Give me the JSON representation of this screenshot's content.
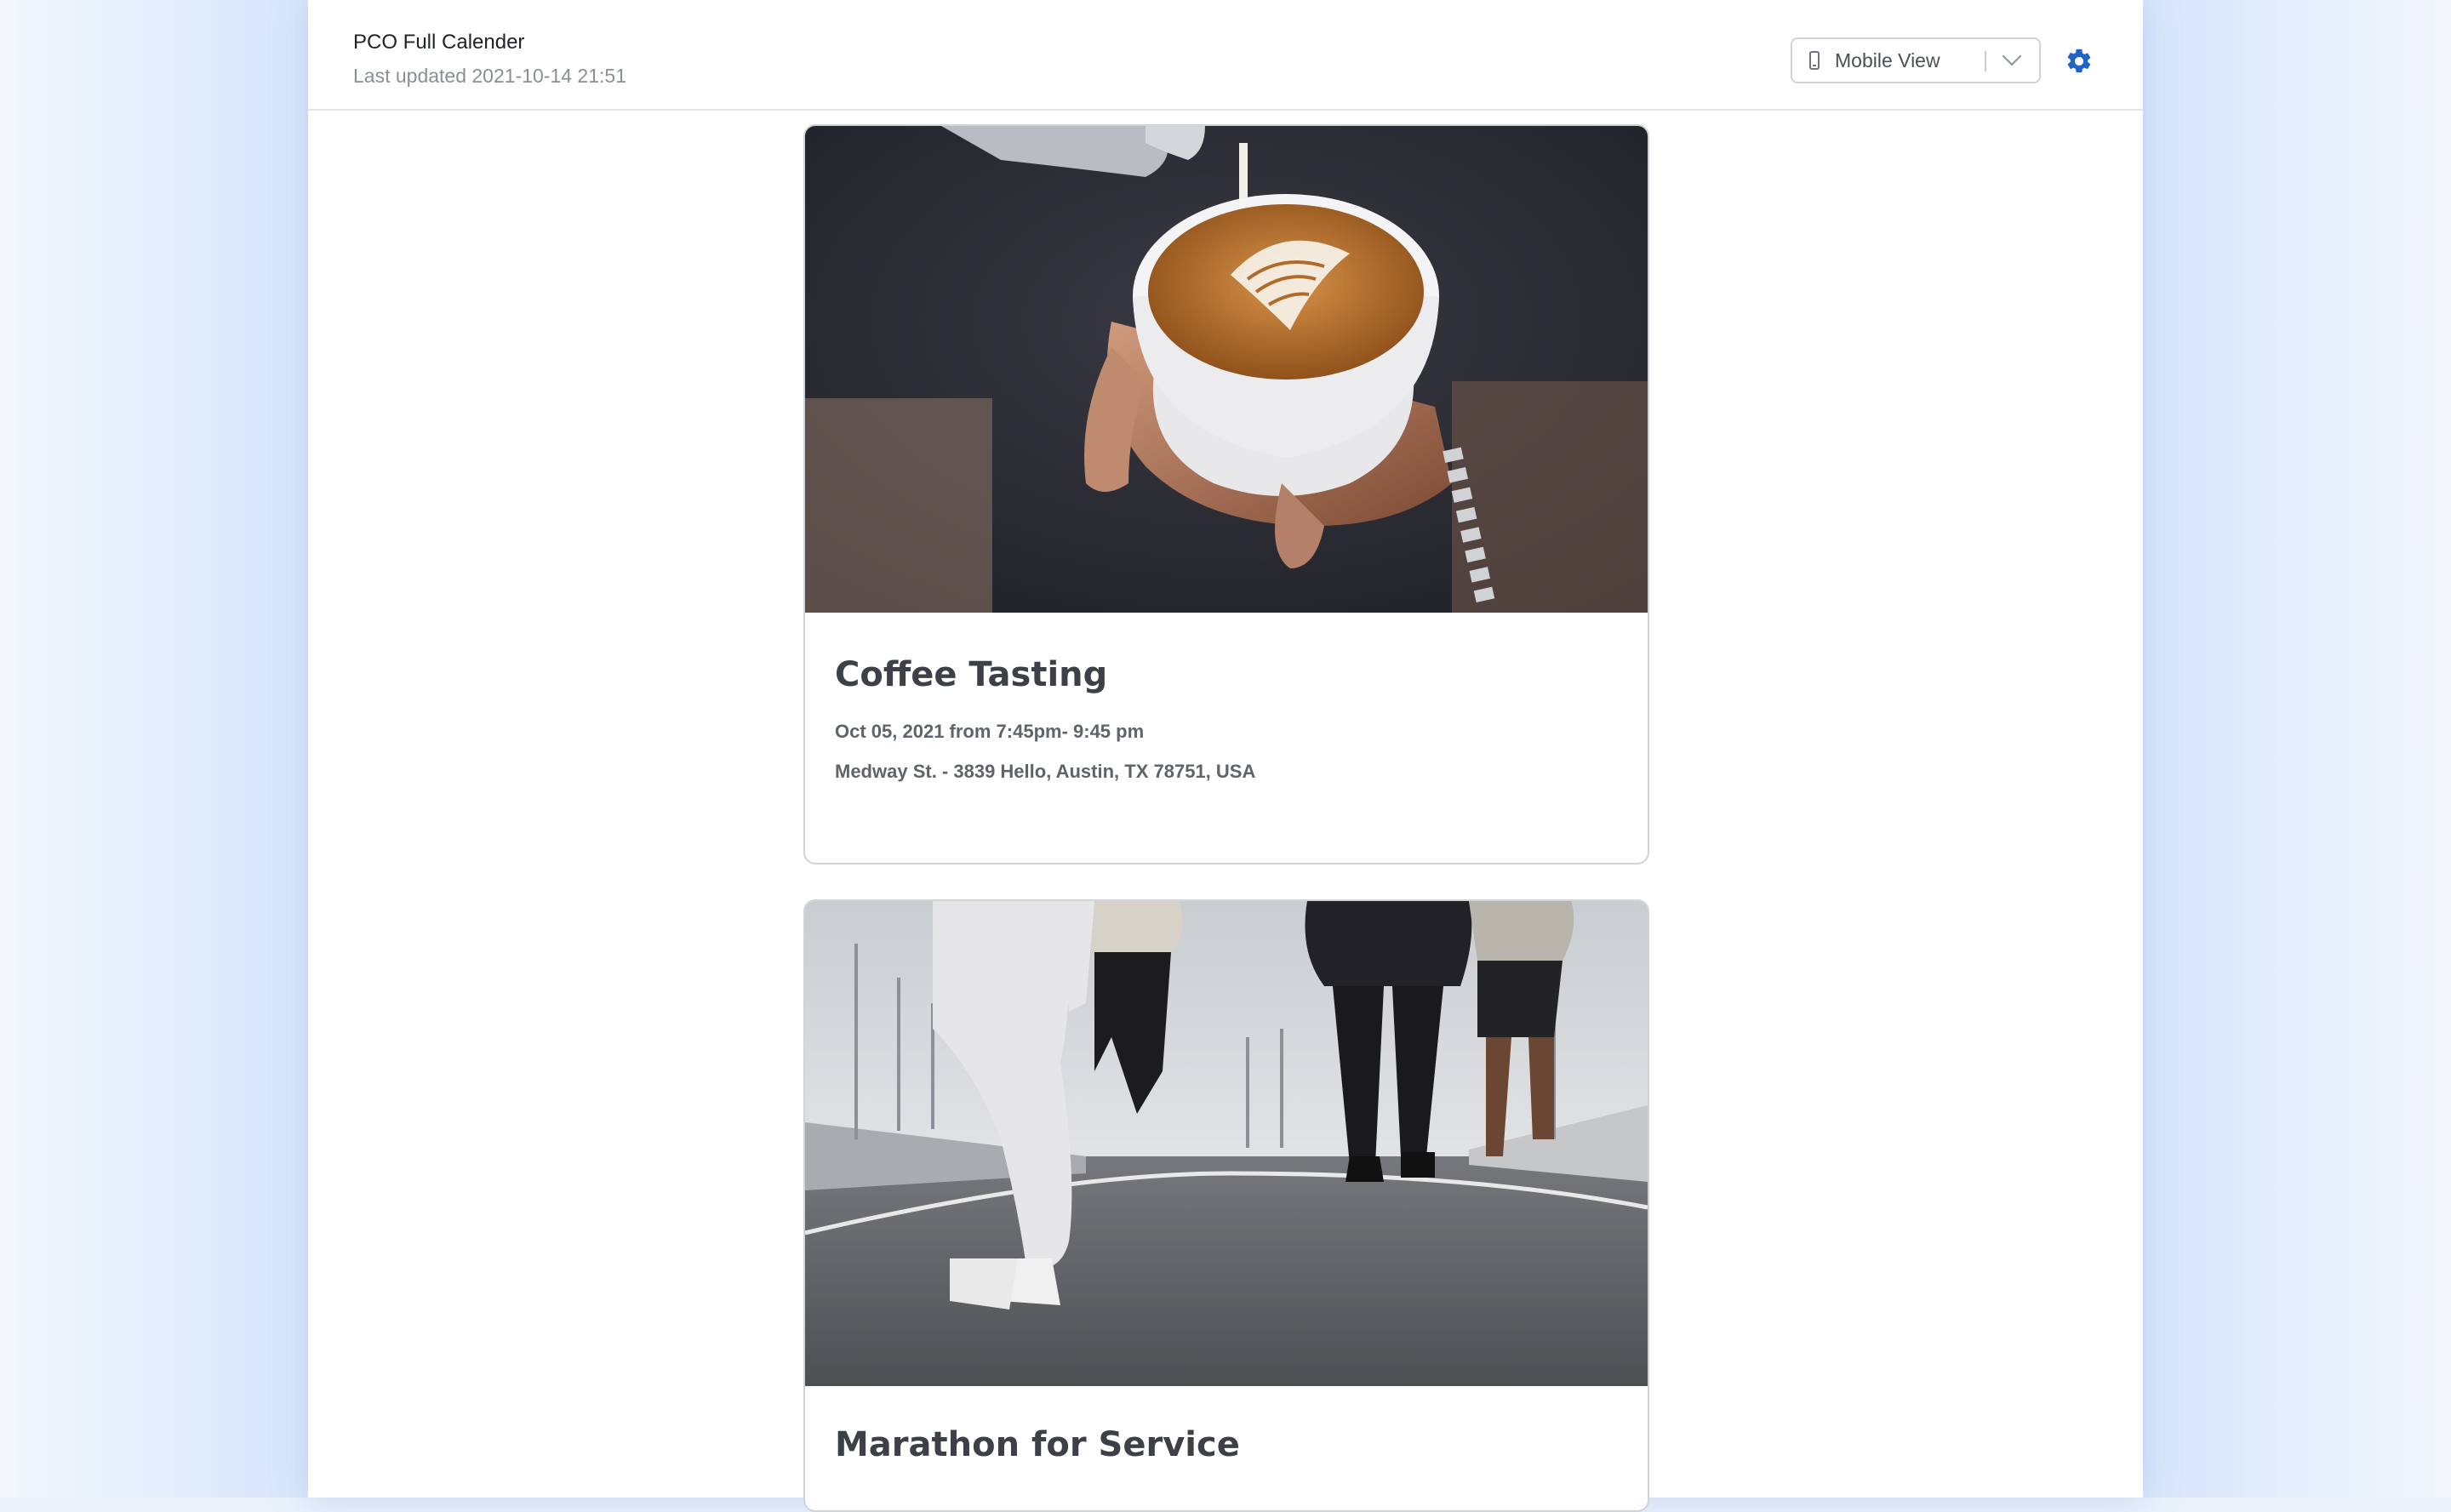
{
  "header": {
    "title": "PCO Full Calender",
    "last_updated": "Last updated 2021-10-14 21:51",
    "view_select": {
      "selected": "Mobile View",
      "icon": "mobile-phone-icon"
    },
    "settings_icon": "gear-icon",
    "accent_color": "#1e63c8"
  },
  "events": [
    {
      "title": "Coffee Tasting",
      "datetime": "Oct 05, 2021 from 7:45pm- 9:45 pm",
      "location": "Medway St. - 3839 Hello, Austin, TX 78751, USA",
      "image": "latte-art-photo"
    },
    {
      "title": "Marathon for Service",
      "image": "runners-on-road-photo"
    }
  ]
}
